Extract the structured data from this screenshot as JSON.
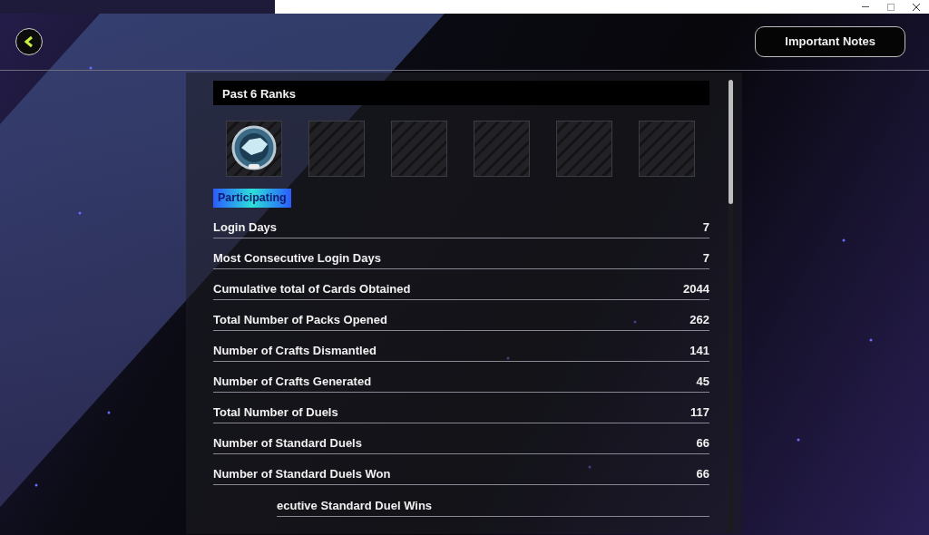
{
  "header": {
    "notes_button": "Important Notes"
  },
  "panel": {
    "title": "Past 6 Ranks",
    "ranks": [
      {
        "kind": "emblem"
      },
      {
        "kind": "empty"
      },
      {
        "kind": "empty"
      },
      {
        "kind": "empty"
      },
      {
        "kind": "empty"
      },
      {
        "kind": "empty"
      }
    ],
    "status_badge": "Participating",
    "stats": [
      {
        "kind": "full",
        "label": "Login Days",
        "value": "7"
      },
      {
        "kind": "full",
        "label": "Most Consecutive Login Days",
        "value": "7"
      },
      {
        "kind": "full",
        "label": "Cumulative total of Cards Obtained",
        "value": "2044"
      },
      {
        "kind": "full",
        "label": "Total Number of Packs Opened",
        "value": "262"
      },
      {
        "kind": "full",
        "label": "Number of Crafts Dismantled",
        "value": "141"
      },
      {
        "kind": "full",
        "label": "Number of Crafts Generated",
        "value": "45"
      },
      {
        "kind": "full",
        "label": "Total Number of Duels",
        "value": "117"
      },
      {
        "kind": "full",
        "label": "Number of Standard Duels",
        "value": "66"
      },
      {
        "kind": "full",
        "label": "Number of Standard Duels Won",
        "value": "66"
      },
      {
        "kind": "cut",
        "label": "ecutive Standard Duel Wins"
      }
    ]
  }
}
